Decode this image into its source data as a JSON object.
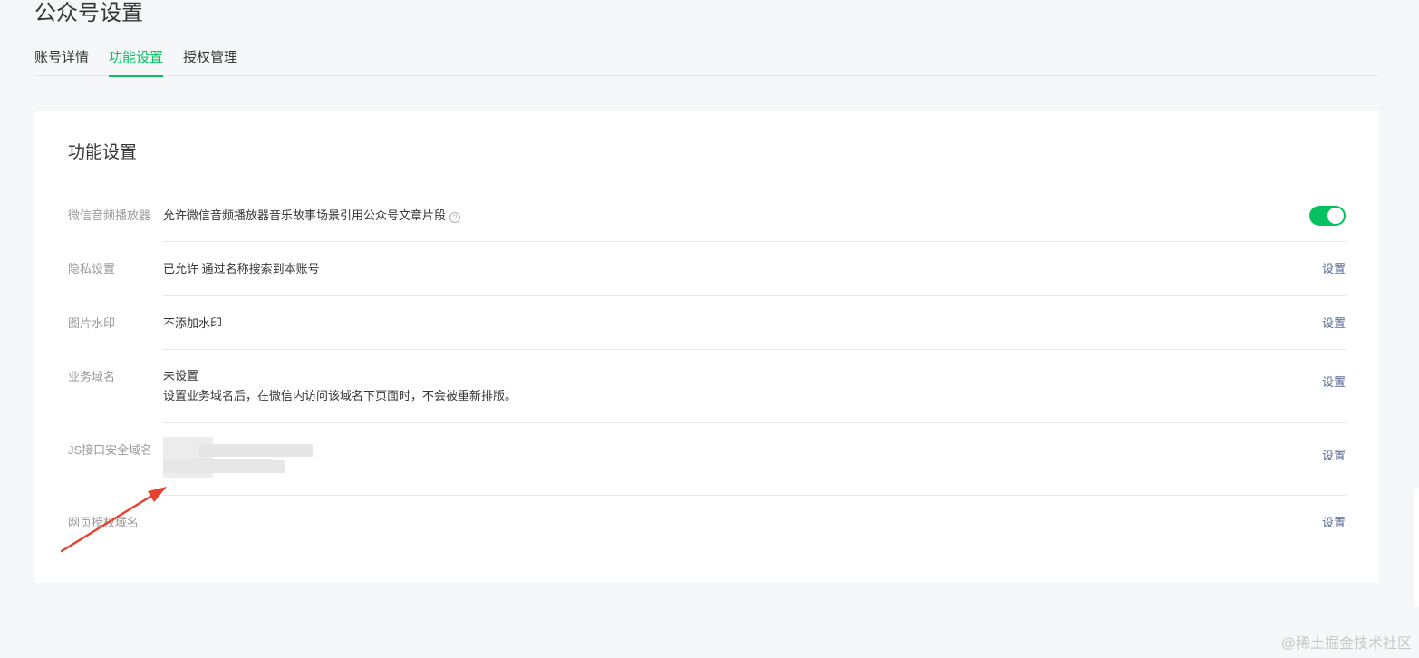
{
  "page": {
    "title": "公众号设置"
  },
  "tabs": [
    {
      "label": "账号详情",
      "active": false
    },
    {
      "label": "功能设置",
      "active": true
    },
    {
      "label": "授权管理",
      "active": false
    }
  ],
  "card": {
    "title": "功能设置",
    "rows": [
      {
        "label": "微信音频播放器",
        "content": "允许微信音频播放器音乐故事场景引用公众号文章片段",
        "toggle_on": true
      },
      {
        "label": "隐私设置",
        "content": "已允许 通过名称搜索到本账号",
        "action": "设置"
      },
      {
        "label": "图片水印",
        "content": "不添加水印",
        "action": "设置"
      },
      {
        "label": "业务域名",
        "content": "未设置",
        "content2": "设置业务域名后，在微信内访问该域名下页面时，不会被重新排版。",
        "action": "设置"
      },
      {
        "label": "JS接口安全域名",
        "action": "设置"
      },
      {
        "label": "网页授权域名",
        "action": "设置"
      }
    ]
  },
  "watermark": "@稀土掘金技术社区",
  "colors": {
    "accent": "#07c160",
    "link": "#576b95",
    "arrow": "#e8412f"
  },
  "icons": {
    "help": "question-circle-icon",
    "annotation": "red-arrow-icon"
  }
}
